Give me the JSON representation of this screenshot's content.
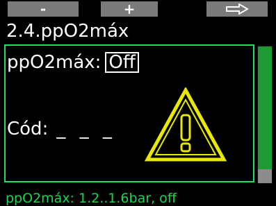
{
  "softkeys": {
    "left_label": "-",
    "middle_label": "+",
    "right_icon": "arrow-right-outline-icon"
  },
  "title": "2.4.ppO2máx",
  "setting": {
    "label": "ppO2máx:",
    "value": "Off"
  },
  "code": {
    "label": "Cód:",
    "value": "_ _ _"
  },
  "warning_icon": "warning-triangle-icon",
  "footer_hint": "ppO2máx: 1.2..1.6bar, off",
  "colors": {
    "frame": "#1ee05a",
    "scrollbar": "#1e9a34",
    "warning": "#e8e800",
    "footer": "#16d848",
    "softkey_bg": "#7a7a7a"
  }
}
